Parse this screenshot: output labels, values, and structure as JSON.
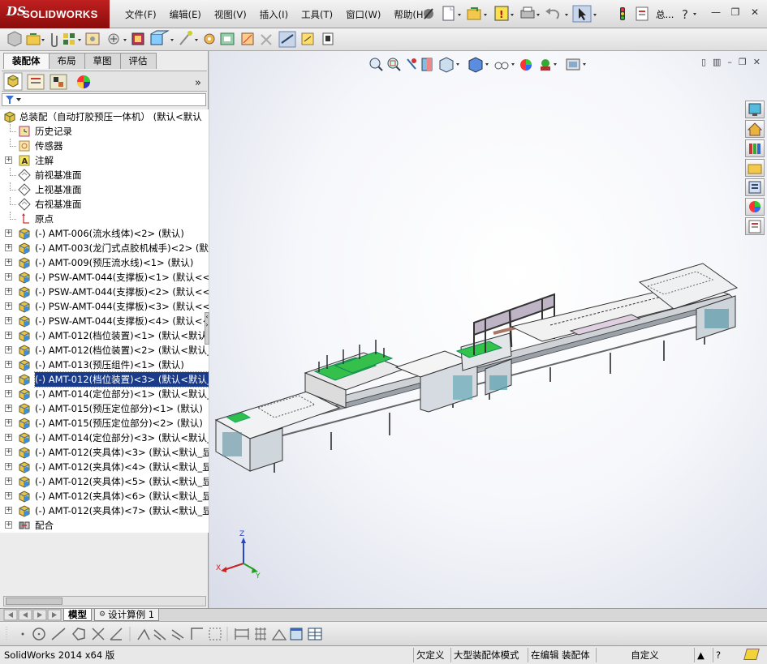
{
  "app": {
    "brand_mark": "DS",
    "brand_name": "SOLIDWORKS",
    "colors": {
      "accent": "#c01818",
      "selection": "#1a3b8a",
      "tree_bg": "#ffffff"
    }
  },
  "menubar": {
    "items": [
      "文件(F)",
      "编辑(E)",
      "视图(V)",
      "插入(I)",
      "工具(T)",
      "窗口(W)",
      "帮助(H)"
    ],
    "search_label": "总..."
  },
  "feature_manager": {
    "tabs": [
      "装配体",
      "布局",
      "草图",
      "评估"
    ],
    "active_tab": "装配体",
    "filter_icon": "funnel-icon",
    "tree": [
      {
        "label": "总装配（自动打胶预压一体机） (默认<默认",
        "icon": "assembly-icon",
        "expand": false
      },
      {
        "label": "历史记录",
        "icon": "history-icon",
        "expand": false
      },
      {
        "label": "传感器",
        "icon": "sensor-icon",
        "expand": false
      },
      {
        "label": "注解",
        "icon": "annotation-icon",
        "expand": true
      },
      {
        "label": "前视基准面",
        "icon": "plane-icon",
        "expand": false
      },
      {
        "label": "上视基准面",
        "icon": "plane-icon",
        "expand": false
      },
      {
        "label": "右视基准面",
        "icon": "plane-icon",
        "expand": false
      },
      {
        "label": "原点",
        "icon": "origin-icon",
        "expand": false
      },
      {
        "label": "(-) AMT-006(流水线体)<2> (默认)",
        "icon": "subassembly-icon",
        "expand": true
      },
      {
        "label": "(-) AMT-003(龙门式点胶机械手)<2> (默认)",
        "icon": "subassembly-icon",
        "expand": true
      },
      {
        "label": "(-) AMT-009(预压流水线)<1> (默认)",
        "icon": "subassembly-icon",
        "expand": true
      },
      {
        "label": "(-) PSW-AMT-044(支撑板)<1> (默认<<默认",
        "icon": "subassembly-icon",
        "expand": true
      },
      {
        "label": "(-) PSW-AMT-044(支撑板)<2> (默认<<默认",
        "icon": "subassembly-icon",
        "expand": true
      },
      {
        "label": "(-) PSW-AMT-044(支撑板)<3> (默认<<默认",
        "icon": "subassembly-icon",
        "expand": true
      },
      {
        "label": "(-) PSW-AMT-044(支撑板)<4> (默认<<默认",
        "icon": "subassembly-icon",
        "expand": true
      },
      {
        "label": "(-) AMT-012(档位装置)<1> (默认<默认_显",
        "icon": "subassembly-icon",
        "expand": true
      },
      {
        "label": "(-) AMT-012(档位装置)<2> (默认<默认_显",
        "icon": "subassembly-icon",
        "expand": true
      },
      {
        "label": "(-) AMT-013(预压组件)<1> (默认)",
        "icon": "subassembly-icon",
        "expand": true
      },
      {
        "label": "(-) AMT-012(档位装置)<3> (默认<默认_显",
        "icon": "subassembly-icon",
        "expand": true,
        "selected": true
      },
      {
        "label": "(-) AMT-014(定位部分)<1> (默认<默认_显",
        "icon": "subassembly-icon",
        "expand": true
      },
      {
        "label": "(-) AMT-015(预压定位部分)<1> (默认)",
        "icon": "subassembly-icon",
        "expand": true
      },
      {
        "label": "(-) AMT-015(预压定位部分)<2> (默认)",
        "icon": "subassembly-icon",
        "expand": true
      },
      {
        "label": "(-) AMT-014(定位部分)<3> (默认<默认_显",
        "icon": "subassembly-icon",
        "expand": true
      },
      {
        "label": "(-) AMT-012(夹具体)<3> (默认<默认_显示",
        "icon": "subassembly-icon",
        "expand": true
      },
      {
        "label": "(-) AMT-012(夹具体)<4> (默认<默认_显示",
        "icon": "subassembly-icon",
        "expand": true
      },
      {
        "label": "(-) AMT-012(夹具体)<5> (默认<默认_显示",
        "icon": "subassembly-icon",
        "expand": true
      },
      {
        "label": "(-) AMT-012(夹具体)<6> (默认<默认_显示",
        "icon": "subassembly-icon",
        "expand": true
      },
      {
        "label": "(-) AMT-012(夹具体)<7> (默认<默认_显示",
        "icon": "subassembly-icon",
        "expand": true
      },
      {
        "label": "配合",
        "icon": "mates-icon",
        "expand": true
      }
    ]
  },
  "sheet_tabs": [
    "模型",
    "设计算例 1"
  ],
  "triad": {
    "x": "X",
    "y": "Y",
    "z": "Z"
  },
  "statusbar": {
    "version": "SolidWorks 2014 x64 版",
    "undefined": "欠定义",
    "mode": "大型装配体模式",
    "editing": "在编辑 装配体",
    "units": "自定义"
  }
}
